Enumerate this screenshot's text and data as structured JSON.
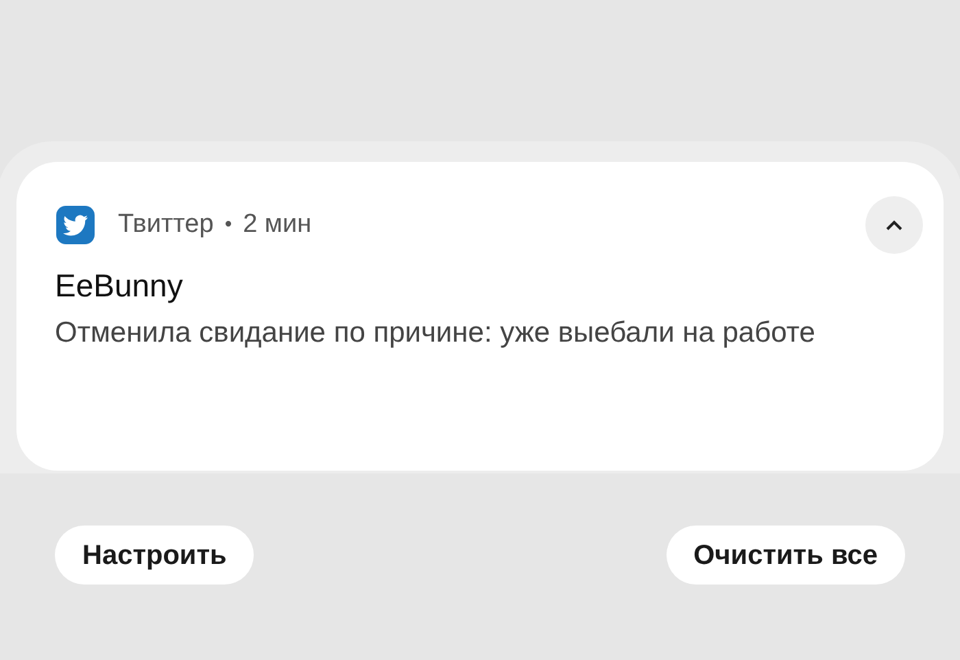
{
  "notification": {
    "app": "Твиттер",
    "separator": "•",
    "time": "2 мин",
    "expanded": true,
    "title": "EeBunny",
    "text": "Отменила свидание по причине: уже выебали на работе"
  },
  "buttons": [
    {
      "label": "Настроить"
    },
    {
      "label": "Очистить все"
    }
  ]
}
